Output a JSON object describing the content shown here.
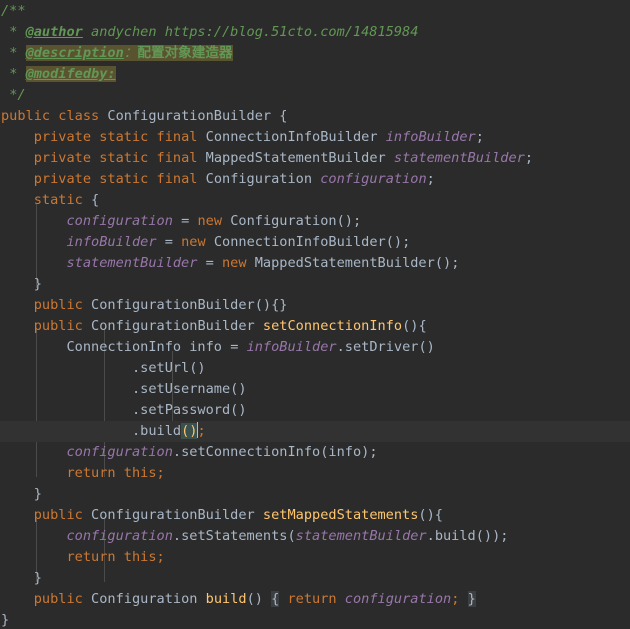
{
  "editor": {
    "language": "java",
    "theme": "darcula",
    "background": "#2b2b2b",
    "current_line_background": "#323232",
    "default_text_color": "#a9b7c6",
    "keyword_color": "#cc7832",
    "field_color": "#9876aa",
    "method_decl_color": "#ffc66d",
    "comment_color": "#629755",
    "highlight_color": "#5a5330",
    "bracket_match_color": "#3b514d",
    "fold_color": "#3c3f41",
    "caret_color": "#bbbbbb"
  },
  "comment_block": {
    "open": "/**",
    "star": "*",
    "author_tag": "@author",
    "author_value": " andychen https://blog.51cto.com/14815984",
    "description_tag": "@description",
    "description_sep": "：",
    "description_value": "配置对象建造器",
    "modifedby_tag": "@modifedby:",
    "close": "*/"
  },
  "code": {
    "kw_public": "public",
    "kw_class": "class",
    "kw_private": "private",
    "kw_static": "static",
    "kw_final": "final",
    "kw_new": "new",
    "kw_return": "return",
    "kw_this": "this",
    "class_name": "ConfigurationBuilder",
    "type_connection_info_builder": "ConnectionInfoBuilder",
    "type_mapped_statement_builder": "MappedStatementBuilder",
    "type_configuration": "Configuration",
    "type_connection_info": "ConnectionInfo",
    "field_info_builder": "infoBuilder",
    "field_statement_builder": "statementBuilder",
    "field_configuration": "configuration",
    "var_info": "info",
    "method_set_connection_info": "setConnectionInfo",
    "method_set_mapped_statements": "setMappedStatements",
    "method_build": "build",
    "call_set_driver": "setDriver",
    "call_set_url": "setUrl",
    "call_set_username": "setUsername",
    "call_set_password": "setPassword",
    "call_build": "build",
    "call_set_connection_info": "setConnectionInfo",
    "call_set_statements": "setStatements",
    "p_open": "(",
    "p_close": ")",
    "p_empty": "()",
    "brace_open": "{",
    "brace_close": "}",
    "brace_pair": "{}",
    "semi": ";",
    "dot": ".",
    "eq": "=",
    "close_paren_semi": ");",
    "build_call_close": "());",
    "fold_open": "{",
    "fold_body": " return ",
    "fold_close": "}"
  }
}
